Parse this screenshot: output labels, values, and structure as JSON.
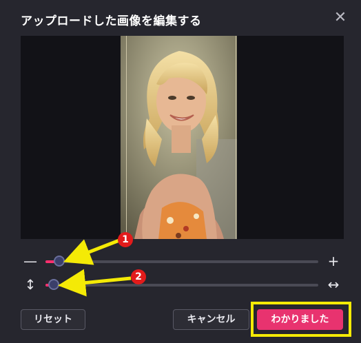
{
  "dialog": {
    "title": "アップロードした画像を編集する",
    "close_icon": "close-icon"
  },
  "preview": {
    "description_icon": "photo-preview"
  },
  "zoom_slider": {
    "left_icon_glyph": "—",
    "right_icon_glyph": "+",
    "value_fraction": 0.05
  },
  "position_slider": {
    "left_icon_glyph": "↕",
    "right_icon_glyph": "↔",
    "value_fraction": 0.03
  },
  "annotations": {
    "marker1": "1",
    "marker2": "2",
    "arrow_color": "#f4ea06",
    "marker_color": "#e21b1b",
    "highlight_color": "#f4ea06"
  },
  "buttons": {
    "reset": "リセット",
    "cancel": "キャンセル",
    "ok": "わかりました"
  },
  "colors": {
    "accent": "#e8336f",
    "slider_fill": "#ff2f6e"
  }
}
